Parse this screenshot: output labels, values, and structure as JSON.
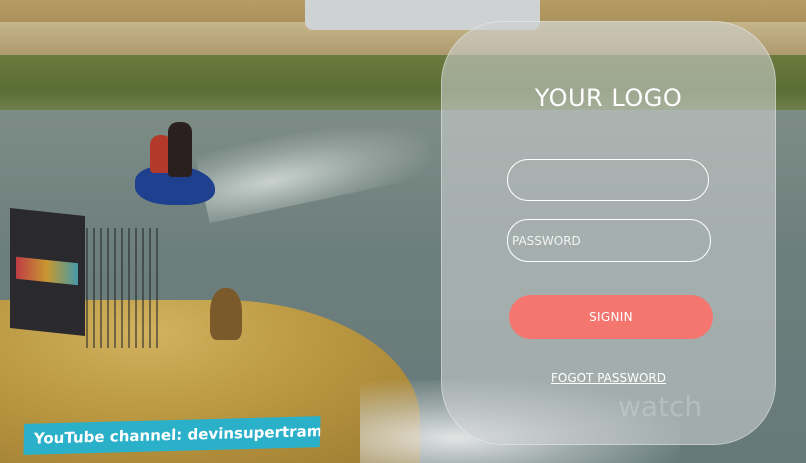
{
  "login": {
    "logo_text": "YOUR LOGO",
    "username": {
      "value": "",
      "placeholder": ""
    },
    "password": {
      "value": "",
      "placeholder": "PASSWORD"
    },
    "signin_label": "SIGNIN",
    "forgot_label": "FOGOT PASSWORD"
  },
  "background": {
    "banner_text": "YouTube channel: devinsupertramp",
    "watermark_text": "watch"
  },
  "colors": {
    "signin_button": "#f5766f",
    "panel": "#cdd0d0",
    "banner": "#2bb0c9",
    "text": "#ffffff"
  }
}
